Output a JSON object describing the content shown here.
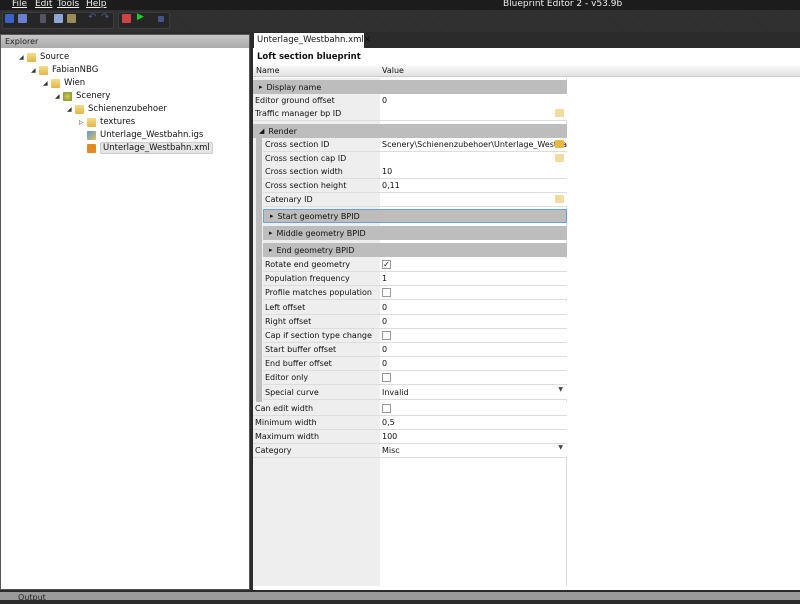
{
  "window": {
    "title": "Blueprint Editor 2 - v53.9b"
  },
  "menu": [
    "File",
    "Edit",
    "Tools",
    "Help"
  ],
  "toolbar": {
    "icons": [
      "save-icon",
      "save-all-icon",
      "cut-icon",
      "copy-icon",
      "paste-icon",
      "undo-icon",
      "redo-icon",
      "build-icon",
      "run-icon",
      "stop-icon"
    ]
  },
  "explorer": {
    "title": "Explorer",
    "tree": [
      {
        "label": "Source",
        "level": 0,
        "expanded": true,
        "icon": "folder-icon"
      },
      {
        "label": "FabianNBG",
        "level": 1,
        "expanded": true,
        "icon": "folder-icon"
      },
      {
        "label": "Wien",
        "level": 2,
        "expanded": true,
        "icon": "folder-icon"
      },
      {
        "label": "Scenery",
        "level": 3,
        "expanded": true,
        "icon": "scenery-icon"
      },
      {
        "label": "Schienenzubehoer",
        "level": 4,
        "expanded": true,
        "icon": "folder-icon"
      },
      {
        "label": "textures",
        "level": 5,
        "expanded": false,
        "icon": "folder-icon"
      },
      {
        "label": "Unterlage_Westbahn.igs",
        "level": 5,
        "icon": "igs-file-icon"
      },
      {
        "label": "Unterlage_Westbahn.xml",
        "level": 5,
        "icon": "xml-file-icon",
        "selected": true
      }
    ]
  },
  "document": {
    "tab": "Unterlage_Westbahn.xml",
    "close": "✕",
    "title": "Loft section blueprint",
    "col_name": "Name",
    "col_value": "Value",
    "rows": [
      {
        "type": "group",
        "name": "Display name",
        "expanded": false,
        "indent": 0
      },
      {
        "type": "prop",
        "name": "Editor ground offset",
        "value": "0",
        "indent": 0
      },
      {
        "type": "prop",
        "name": "Traffic manager bp ID",
        "value": "",
        "control": "folder",
        "indent": 0
      },
      {
        "type": "group",
        "name": "Render",
        "expanded": true,
        "indent": 0
      },
      {
        "type": "prop",
        "name": "Cross section ID",
        "value": "Scenery\\Schienenzubehoer\\Unterlage_Westbah",
        "control": "folder",
        "indent": 1
      },
      {
        "type": "prop",
        "name": "Cross section cap ID",
        "value": "",
        "control": "folder",
        "indent": 1
      },
      {
        "type": "prop",
        "name": "Cross section width",
        "value": "10",
        "indent": 1
      },
      {
        "type": "prop",
        "name": "Cross section height",
        "value": "0,11",
        "indent": 1
      },
      {
        "type": "prop",
        "name": "Catenary ID",
        "value": "",
        "control": "folder",
        "indent": 1
      },
      {
        "type": "group",
        "name": "Start geometry BPID",
        "expanded": false,
        "indent": 1,
        "selected": true
      },
      {
        "type": "group",
        "name": "Middle geometry BPID",
        "expanded": false,
        "indent": 1
      },
      {
        "type": "group",
        "name": "End geometry BPID",
        "expanded": false,
        "indent": 1
      },
      {
        "type": "prop",
        "name": "Rotate end geometry",
        "control": "checkbox",
        "checked": true,
        "indent": 1
      },
      {
        "type": "prop",
        "name": "Population frequency",
        "value": "1",
        "indent": 1
      },
      {
        "type": "prop",
        "name": "Profile matches population",
        "control": "checkbox",
        "checked": false,
        "indent": 1
      },
      {
        "type": "prop",
        "name": "Left offset",
        "value": "0",
        "indent": 1
      },
      {
        "type": "prop",
        "name": "Right offset",
        "value": "0",
        "indent": 1
      },
      {
        "type": "prop",
        "name": "Cap if section type change",
        "control": "checkbox",
        "checked": false,
        "indent": 1
      },
      {
        "type": "prop",
        "name": "Start buffer offset",
        "value": "0",
        "indent": 1
      },
      {
        "type": "prop",
        "name": "End buffer offset",
        "value": "0",
        "indent": 1
      },
      {
        "type": "prop",
        "name": "Editor only",
        "control": "checkbox",
        "checked": false,
        "indent": 1
      },
      {
        "type": "prop",
        "name": "Special curve",
        "value": "Invalid",
        "control": "dropdown",
        "indent": 1
      },
      {
        "type": "prop",
        "name": "Can edit width",
        "control": "checkbox",
        "checked": false,
        "indent": 0
      },
      {
        "type": "prop",
        "name": "Minimum width",
        "value": "0,5",
        "indent": 0
      },
      {
        "type": "prop",
        "name": "Maximum width",
        "value": "100",
        "indent": 0
      },
      {
        "type": "prop",
        "name": "Category",
        "value": "Misc",
        "control": "dropdown",
        "indent": 0
      }
    ]
  },
  "output": {
    "title": "Output"
  },
  "colors": {
    "selection_border": "#6a9ee0",
    "group_bg": "#bdbdbd",
    "folder": "#e8b840"
  }
}
